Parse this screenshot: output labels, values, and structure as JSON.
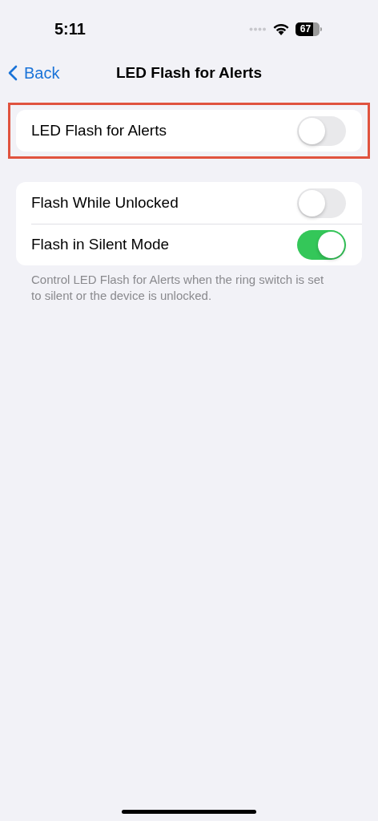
{
  "status_bar": {
    "time": "5:11",
    "battery": "67"
  },
  "nav": {
    "back": "Back",
    "title": "LED Flash for Alerts"
  },
  "groups": [
    {
      "highlighted": true,
      "rows": [
        {
          "label": "LED Flash for Alerts",
          "on": false
        }
      ]
    },
    {
      "highlighted": false,
      "rows": [
        {
          "label": "Flash While Unlocked",
          "on": false
        },
        {
          "label": "Flash in Silent Mode",
          "on": true
        }
      ],
      "footer": "Control LED Flash for Alerts when the ring switch is set to silent or the device is unlocked."
    }
  ]
}
